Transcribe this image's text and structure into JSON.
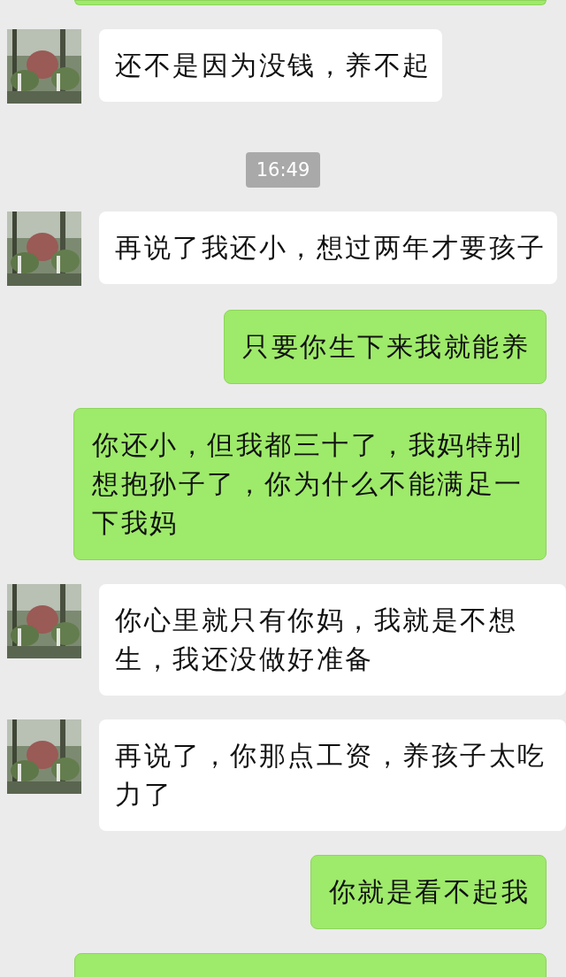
{
  "messages": [
    {
      "kind": "clipped-top"
    },
    {
      "kind": "incoming",
      "text": "还不是因为没钱，养不起"
    },
    {
      "kind": "time",
      "text": "16:49"
    },
    {
      "kind": "incoming",
      "text": "再说了我还小，想过两年才要孩子"
    },
    {
      "kind": "outgoing",
      "text": "只要你生下来我就能养"
    },
    {
      "kind": "outgoing",
      "text": "你还小，但我都三十了，我妈特别想抱孙子了，你为什么不能满足一下我妈"
    },
    {
      "kind": "incoming",
      "text": "你心里就只有你妈，我就是不想生，我还没做好准备"
    },
    {
      "kind": "incoming",
      "text": "再说了，你那点工资，养孩子太吃力了"
    },
    {
      "kind": "outgoing",
      "text": "你就是看不起我"
    },
    {
      "kind": "clipped-bottom"
    }
  ]
}
